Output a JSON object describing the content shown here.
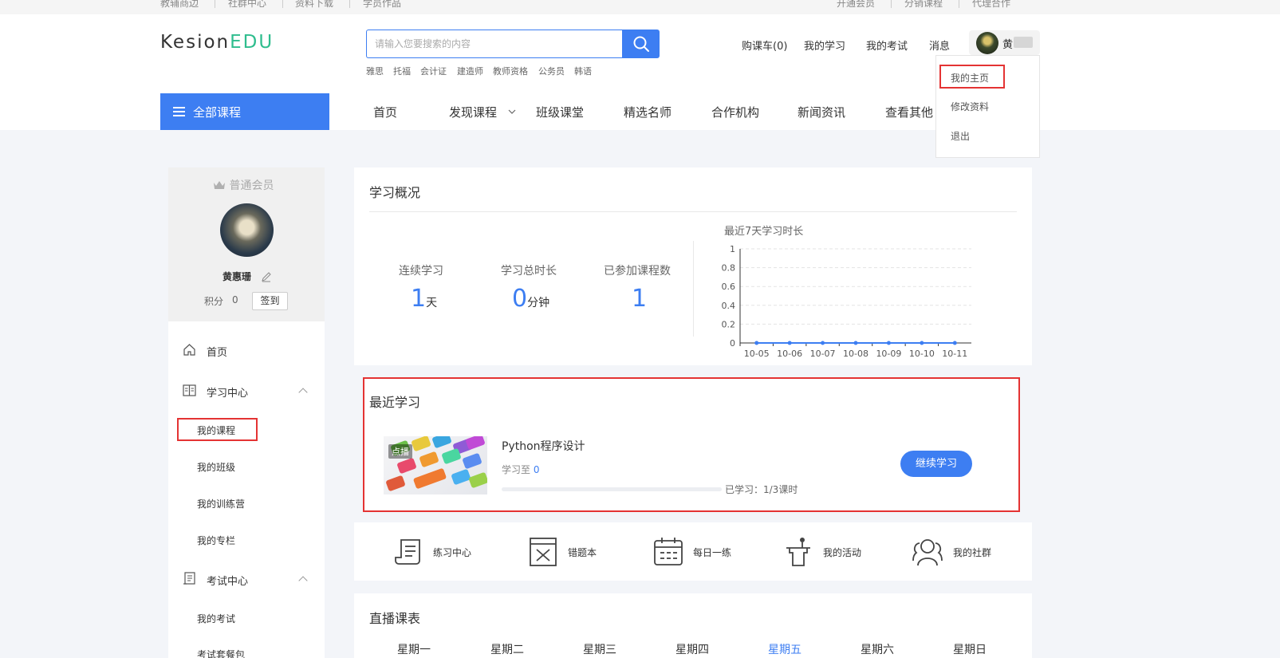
{
  "topbar": {
    "left_links": [
      "教辅商边",
      "社群中心",
      "资料下载",
      "学员作品"
    ],
    "right_links": [
      "开通会员",
      "分销课程",
      "代理合作"
    ]
  },
  "header": {
    "logo_part1": "Kesion",
    "logo_part2": "EDU",
    "search_placeholder": "请输入您要搜索的内容",
    "hot_words": [
      "雅思",
      "托福",
      "会计证",
      "建造师",
      "教师资格",
      "公务员",
      "韩语"
    ],
    "nav_links": [
      "购课车(0)",
      "我的学习",
      "我的考试",
      "消息"
    ],
    "user_short": "黄"
  },
  "user_menu": {
    "items": [
      "我的主页",
      "修改资料",
      "退出"
    ]
  },
  "main_nav": {
    "category_button": "全部课程",
    "items": [
      "首页",
      "发现课程",
      "班级课堂",
      "精选名师",
      "合作机构",
      "新闻资讯",
      "查看其他"
    ]
  },
  "sidebar": {
    "member_level": "普通会员",
    "username": "黄惠珊",
    "points_label": "积分",
    "points_value": "0",
    "signin_label": "签到",
    "home": "首页",
    "study_center": "学习中心",
    "study_items": [
      "我的课程",
      "我的班级",
      "我的训练营",
      "我的专栏"
    ],
    "exam_center": "考试中心",
    "exam_items": [
      "我的考试",
      "考试套餐包"
    ]
  },
  "overview": {
    "title": "学习概况",
    "stats": [
      {
        "label": "连续学习",
        "value": "1",
        "unit": "天"
      },
      {
        "label": "学习总时长",
        "value": "0",
        "unit": "分钟"
      },
      {
        "label": "已参加课程数",
        "value": "1",
        "unit": ""
      }
    ]
  },
  "chart_data": {
    "type": "line",
    "title": "最近7天学习时长",
    "categories": [
      "10-05",
      "10-06",
      "10-07",
      "10-08",
      "10-09",
      "10-10",
      "10-11"
    ],
    "values": [
      0,
      0,
      0,
      0,
      0,
      0,
      0
    ],
    "y_ticks": [
      "0",
      "0.2",
      "0.4",
      "0.6",
      "0.8",
      "1"
    ],
    "ylim": [
      0,
      1
    ],
    "grid": true,
    "line_color": "#3d7ef2"
  },
  "recent": {
    "title": "最近学习",
    "tag": "点播",
    "course_name": "Python程序设计",
    "study_to_label": "学习至",
    "study_to_value": "0",
    "progress_fraction": 0.0,
    "progress_text": "已学习：1/3课时",
    "continue_button": "继续学习"
  },
  "tools": [
    {
      "label": "练习中心",
      "icon": "practice-icon"
    },
    {
      "label": "错题本",
      "icon": "wrong-book-icon"
    },
    {
      "label": "每日一练",
      "icon": "calendar-icon"
    },
    {
      "label": "我的活动",
      "icon": "activity-icon"
    },
    {
      "label": "我的社群",
      "icon": "community-icon"
    }
  ],
  "live": {
    "title": "直播课表",
    "weekdays": [
      "星期一",
      "星期二",
      "星期三",
      "星期四",
      "星期五",
      "星期六",
      "星期日"
    ],
    "active_day": "星期五"
  },
  "colors": {
    "accent": "#3d7ef2",
    "brand_green": "#2fbd8e",
    "highlight_red": "#e43333"
  }
}
